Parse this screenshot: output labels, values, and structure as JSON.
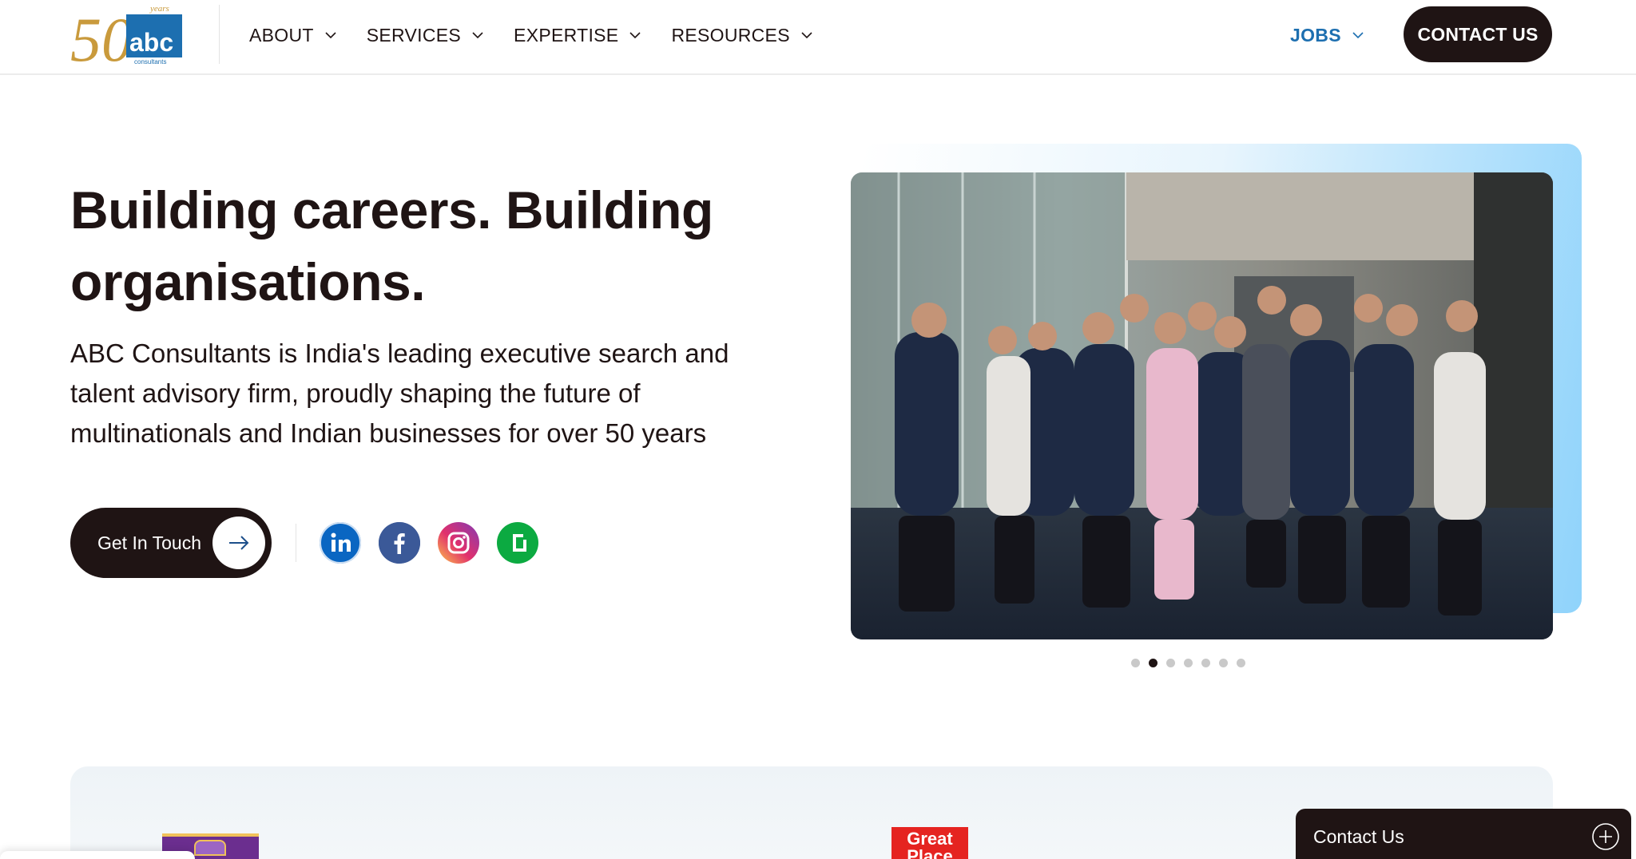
{
  "brand": {
    "logo_number": "50",
    "logo_years": "years",
    "logo_text": "abc",
    "logo_sub": "consultants",
    "logo_blue": "#1d6fb0",
    "logo_gold": "#c99a3c"
  },
  "nav": {
    "items": [
      {
        "label": "ABOUT"
      },
      {
        "label": "SERVICES"
      },
      {
        "label": "EXPERTISE"
      },
      {
        "label": "RESOURCES"
      }
    ],
    "jobs_label": "JOBS",
    "contact_label": "CONTACT US"
  },
  "hero": {
    "title_line1": "Building careers. Building",
    "title_line2": "organisations.",
    "desc_line1": "ABC Consultants is India's leading executive search and",
    "desc_line2": "talent advisory firm, proudly shaping the future of",
    "desc_line3": "multinationals and Indian businesses for over 50 years",
    "cta_label": "Get In Touch"
  },
  "social": [
    {
      "icon": "linkedin-icon",
      "color": "#0a66c2"
    },
    {
      "icon": "facebook-icon",
      "color": "#3b5998"
    },
    {
      "icon": "instagram-icon",
      "color": "#e1306c"
    },
    {
      "icon": "glassdoor-icon",
      "color": "#0caa41"
    }
  ],
  "carousel": {
    "slide_count": 7,
    "active_index": 1
  },
  "awards": {
    "gptw_text": "Great Place"
  },
  "contact_panel": {
    "label": "Contact Us"
  },
  "colors": {
    "primary_dark": "#1f1414",
    "accent_blue": "#1d6fb0"
  }
}
